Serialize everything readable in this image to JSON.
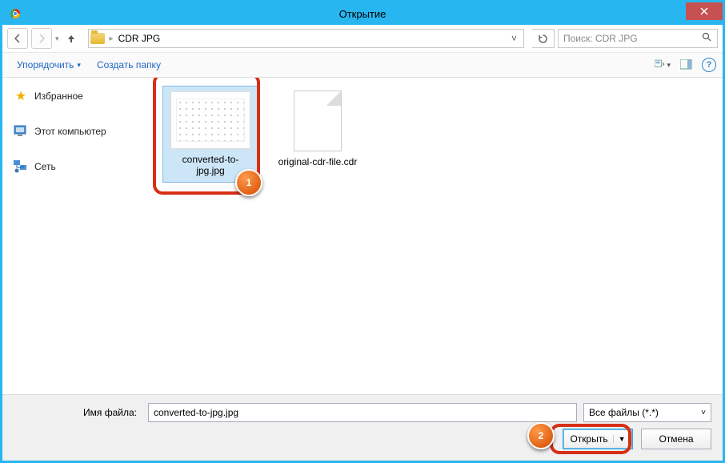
{
  "titlebar": {
    "title": "Открытие"
  },
  "nav": {
    "folder": "CDR JPG"
  },
  "search": {
    "placeholder": "Поиск: CDR JPG"
  },
  "toolbar": {
    "organize": "Упорядочить",
    "new_folder": "Создать папку"
  },
  "sidebar": {
    "favorites": "Избранное",
    "computer": "Этот компьютер",
    "network": "Сеть"
  },
  "files": [
    {
      "name": "converted-to-jpg.jpg",
      "selected": true
    },
    {
      "name": "original-cdr-file.cdr",
      "selected": false
    }
  ],
  "footer": {
    "label": "Имя файла:",
    "filename": "converted-to-jpg.jpg",
    "filter": "Все файлы (*.*)",
    "open": "Открыть",
    "cancel": "Отмена"
  },
  "callouts": {
    "one": "1",
    "two": "2"
  }
}
